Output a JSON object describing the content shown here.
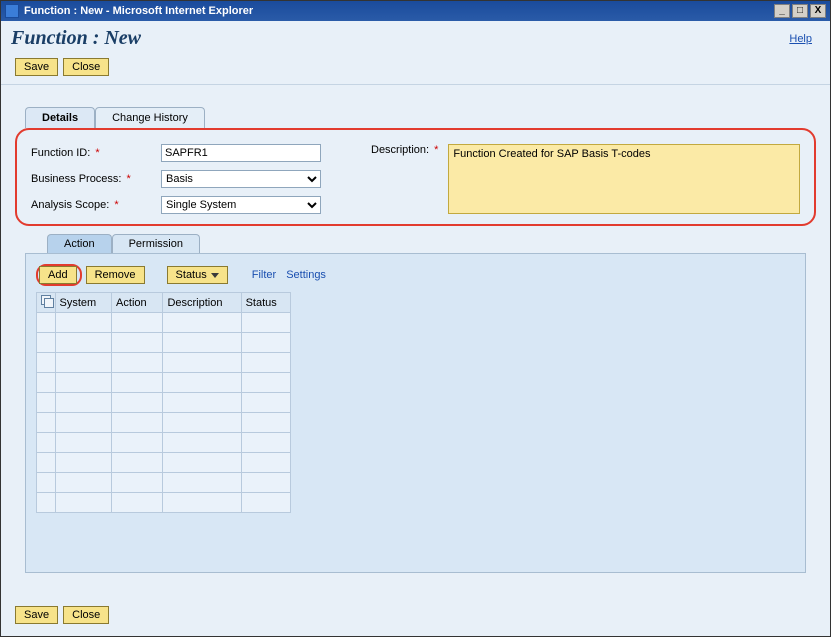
{
  "window": {
    "title": "Function : New - Microsoft Internet Explorer"
  },
  "header": {
    "page_title": "Function : New",
    "help_label": "Help"
  },
  "buttons": {
    "save": "Save",
    "close": "Close",
    "add": "Add",
    "remove": "Remove",
    "status": "Status",
    "filter": "Filter",
    "settings": "Settings"
  },
  "tabs_main": {
    "details": "Details",
    "change_history": "Change History"
  },
  "tabs_sub": {
    "action": "Action",
    "permission": "Permission"
  },
  "form": {
    "function_id_label": "Function ID:",
    "function_id_value": "SAPFR1",
    "business_process_label": "Business Process:",
    "business_process_value": "Basis",
    "analysis_scope_label": "Analysis Scope:",
    "analysis_scope_value": "Single System",
    "description_label": "Description:",
    "description_value": "Function Created for SAP Basis T-codes"
  },
  "grid": {
    "columns": {
      "system": "System",
      "action": "Action",
      "description": "Description",
      "status": "Status"
    }
  }
}
